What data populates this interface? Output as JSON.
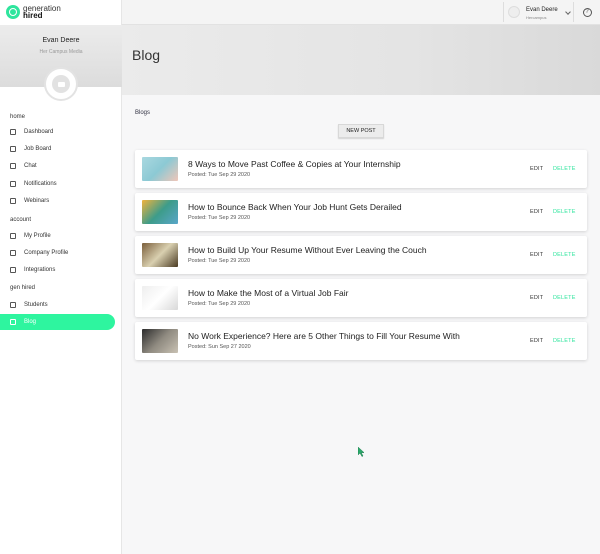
{
  "brand": {
    "line1": "generation",
    "line2": "hired",
    "accent": "#2ef59f"
  },
  "profile": {
    "name": "Evan Deere",
    "org": "Her Campus Media"
  },
  "topbar": {
    "user_name": "Evan Deere",
    "user_org": "Hercampus",
    "help": "?"
  },
  "sidebar": {
    "sections": [
      {
        "title": "home",
        "items": [
          {
            "label": "Dashboard",
            "icon": "dashboard-icon"
          },
          {
            "label": "Job Board",
            "icon": "job-board-icon"
          },
          {
            "label": "Chat",
            "icon": "chat-icon"
          },
          {
            "label": "Notifications",
            "icon": "bell-icon"
          },
          {
            "label": "Webinars",
            "icon": "video-icon"
          }
        ]
      },
      {
        "title": "account",
        "items": [
          {
            "label": "My Profile",
            "icon": "user-icon"
          },
          {
            "label": "Company Profile",
            "icon": "company-icon"
          },
          {
            "label": "Integrations",
            "icon": "integrations-icon"
          }
        ]
      },
      {
        "title": "gen hired",
        "items": [
          {
            "label": "Students",
            "icon": "graduation-icon"
          },
          {
            "label": "Blog",
            "icon": "blog-icon",
            "active": true
          }
        ]
      }
    ]
  },
  "header": {
    "title": "Blog"
  },
  "main": {
    "breadcrumb": "Blogs",
    "new_post_label": "NEW POST",
    "edit_label": "EDIT",
    "delete_label": "DELETE",
    "posts": [
      {
        "title": "8 Ways to Move Past Coffee & Copies at Your Internship",
        "date": "Posted: Tue Sep 29 2020"
      },
      {
        "title": "How to Bounce Back When Your Job Hunt Gets Derailed",
        "date": "Posted: Tue Sep 29 2020"
      },
      {
        "title": "How to Build Up Your Resume Without Ever Leaving the Couch",
        "date": "Posted: Tue Sep 29 2020"
      },
      {
        "title": "How to Make the Most of a Virtual Job Fair",
        "date": "Posted: Tue Sep 29 2020"
      },
      {
        "title": "No Work Experience? Here are 5 Other Things to Fill Your Resume With",
        "date": "Posted: Sun Sep 27 2020"
      }
    ]
  }
}
